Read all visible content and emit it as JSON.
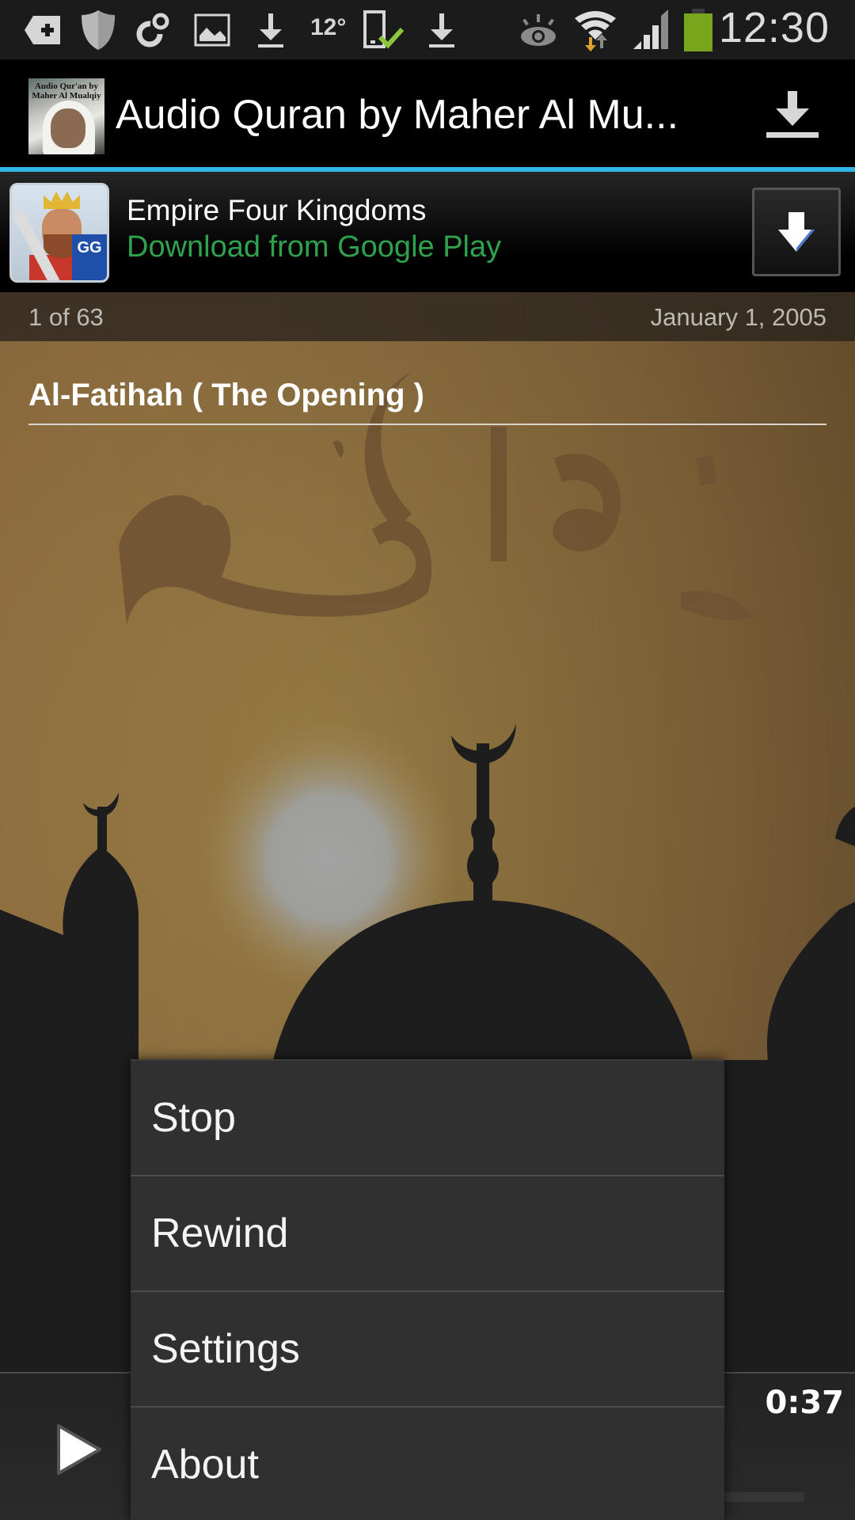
{
  "status_bar": {
    "time": "12:30",
    "temperature": "12°",
    "icons": [
      "add-tag-icon",
      "shield-icon",
      "sync-circles-icon",
      "image-icon",
      "download-icon",
      "temperature-readout",
      "device-check-icon",
      "download-icon",
      "eye-icon",
      "wifi-icon",
      "signal-icon",
      "battery-icon"
    ],
    "battery_color": "#77a61c",
    "wifi_down_arrow_color": "#e0a030"
  },
  "action_bar": {
    "app_icon_caption": "Audio Qur'an by Maher Al Mualqiy",
    "title": "Audio Quran by Maher Al Mu...",
    "download_icon": "download-icon",
    "accent_color": "#33b5e5"
  },
  "ad": {
    "title": "Empire Four Kingdoms",
    "subtitle": "Download from Google Play",
    "subtitle_color": "#2fa24e",
    "badge": "GG",
    "button_icon": "download-arrow-icon"
  },
  "track_info": {
    "counter": "1 of 63",
    "date": "January 1, 2005",
    "title": "Al-Fatihah ( The Opening )"
  },
  "player": {
    "elapsed": "0:37",
    "play_icon": "play-icon",
    "progress": 0.0
  },
  "menu": {
    "items": [
      {
        "label": "Stop"
      },
      {
        "label": "Rewind"
      },
      {
        "label": "Settings"
      },
      {
        "label": "About"
      }
    ]
  }
}
